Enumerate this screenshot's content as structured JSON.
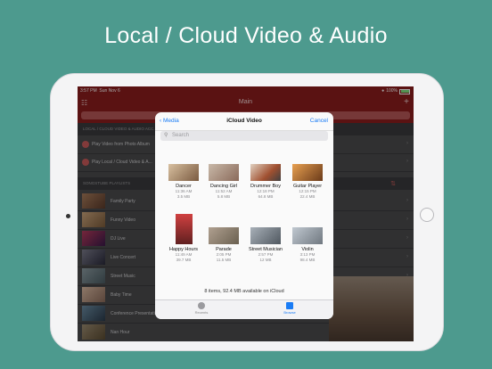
{
  "headline": "Local / Cloud Video & Audio",
  "status": {
    "time": "3:57 PM",
    "date": "Sun Nov 6",
    "battery": "100%"
  },
  "nav": {
    "title": "Main"
  },
  "sections": {
    "local_header": "LOCAL / CLOUD VIDEO & AUDIO ACC...",
    "playlists_header": "SONGSTUBE PLAYLISTS"
  },
  "local_rows": [
    {
      "label": "Play Video from Photo Album"
    },
    {
      "label": "Play Local / Cloud Video & A..."
    }
  ],
  "playlists": [
    {
      "label": "Family Party"
    },
    {
      "label": "Funny Video"
    },
    {
      "label": "DJ Live"
    },
    {
      "label": "Live Concert"
    },
    {
      "label": "Street Music"
    },
    {
      "label": "Baby Time"
    },
    {
      "label": "Conference Presentation"
    },
    {
      "label": "Nan Hour"
    }
  ],
  "picker": {
    "back_label": "Media",
    "title": "iCloud Video",
    "cancel_label": "Cancel",
    "search_placeholder": "Search",
    "items": [
      {
        "name": "Dancer",
        "time": "11:36 AM",
        "size": "3.5 MB"
      },
      {
        "name": "Dancing Girl",
        "time": "11:52 AM",
        "size": "5.8 MB"
      },
      {
        "name": "Drummer Boy",
        "time": "12:18 PM",
        "size": "64.8 MB"
      },
      {
        "name": "Guitar Player",
        "time": "12:15 PM",
        "size": "22.4 MB"
      },
      {
        "name": "Happy Hours",
        "time": "11:49 AM",
        "size": "39.7 MB"
      },
      {
        "name": "Parade",
        "time": "2:05 PM",
        "size": "11.5 MB"
      },
      {
        "name": "Street Musician",
        "time": "2:57 PM",
        "size": "12 MB"
      },
      {
        "name": "Violin",
        "time": "3:13 PM",
        "size": "98.4 MB"
      }
    ],
    "footer": "8 items, 92.4 MB available on iCloud",
    "tabs": [
      {
        "label": "Recents"
      },
      {
        "label": "Browse"
      }
    ]
  },
  "colors": {
    "background": "#4d9a8e",
    "brand": "#8b1c1c",
    "link": "#1a7cf5"
  }
}
